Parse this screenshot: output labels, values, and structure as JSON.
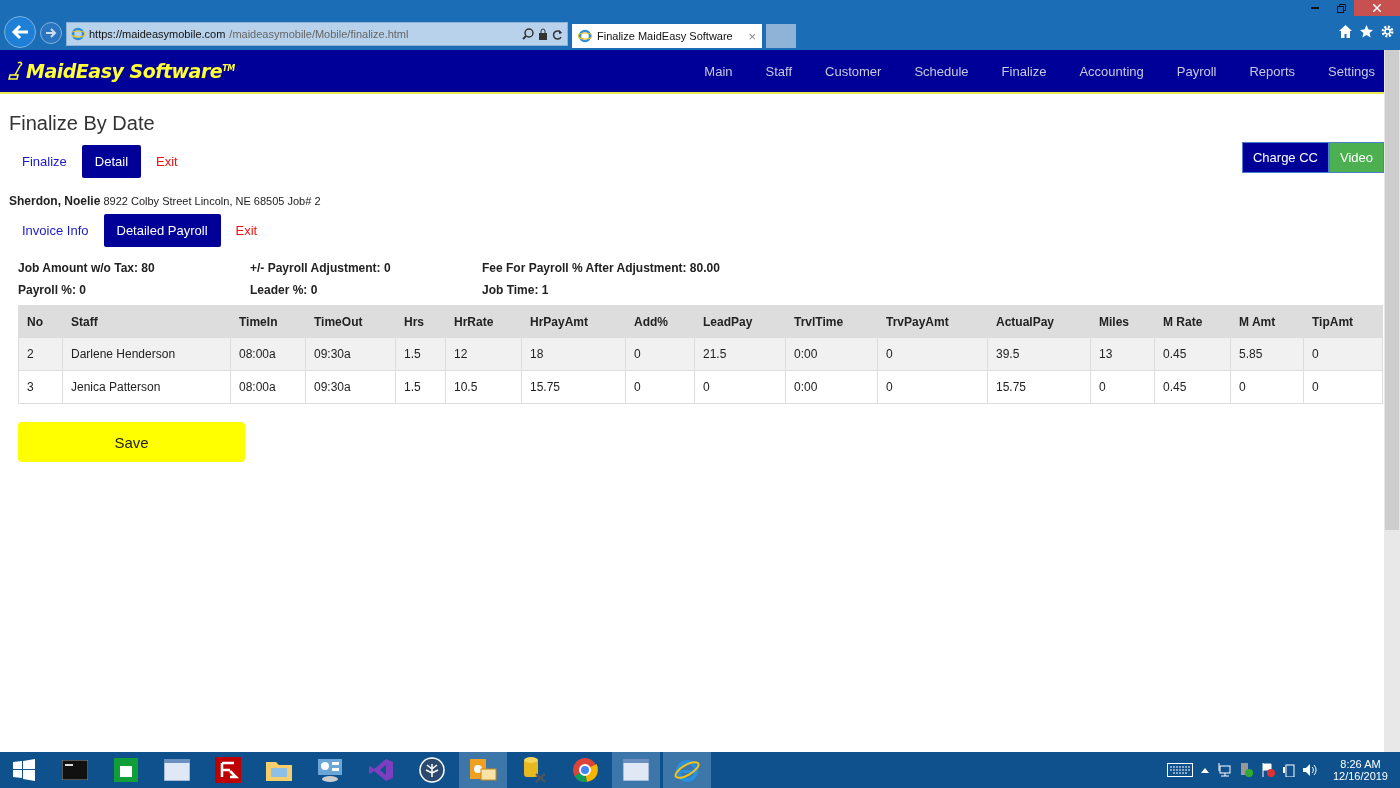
{
  "browser": {
    "address": {
      "host": "https://maideasymobile.com",
      "path": "/maideasymobile/Mobile/finalize.html"
    },
    "tabs": [
      {
        "title": "Finalize MaidEasy Software",
        "close": "×",
        "selected": true
      }
    ]
  },
  "nav": {
    "logo": "MaidEasy Software",
    "trademark": "TM",
    "items": [
      "Main",
      "Staff",
      "Customer",
      "Schedule",
      "Finalize",
      "Accounting",
      "Payroll",
      "Reports",
      "Settings"
    ]
  },
  "page": {
    "title": "Finalize By Date",
    "tabs": [
      {
        "label": "Finalize",
        "kind": "link",
        "selected": false
      },
      {
        "label": "Detail",
        "kind": "link",
        "selected": true
      },
      {
        "label": "Exit",
        "kind": "exit",
        "selected": false
      }
    ],
    "actions": [
      {
        "label": "Charge CC",
        "color": "#000099"
      },
      {
        "label": "Video",
        "color": "#4caf50"
      }
    ],
    "customer": {
      "name": "Sherdon, Noelie",
      "details": "8922 Colby Street Lincoln, NE 68505 Job# 2"
    },
    "subtabs": [
      {
        "label": "Invoice Info",
        "kind": "link",
        "selected": false
      },
      {
        "label": "Detailed Payroll",
        "kind": "link",
        "selected": true
      },
      {
        "label": "Exit",
        "kind": "exit",
        "selected": false
      }
    ],
    "summary": [
      "Job Amount w/o Tax: 80",
      "+/- Payroll Adjustment: 0",
      "Fee For Payroll % After Adjustment: 80.00",
      "Payroll %: 0",
      "Leader %: 0",
      "Job Time: 1"
    ],
    "table": {
      "columns": [
        "No",
        "Staff",
        "TimeIn",
        "TimeOut",
        "Hrs",
        "HrRate",
        "HrPayAmt",
        "Add%",
        "LeadPay",
        "TrvlTime",
        "TrvPayAmt",
        "ActualPay",
        "Miles",
        "M Rate",
        "M Amt",
        "TipAmt"
      ],
      "rows": [
        [
          "2",
          "Darlene Henderson",
          "08:00a",
          "09:30a",
          "1.5",
          "12",
          "18",
          "0",
          "21.5",
          "0:00",
          "0",
          "39.5",
          "13",
          "0.45",
          "5.85",
          "0"
        ],
        [
          "3",
          "Jenica Patterson",
          "08:00a",
          "09:30a",
          "1.5",
          "10.5",
          "15.75",
          "0",
          "0",
          "0:00",
          "0",
          "15.75",
          "0",
          "0.45",
          "0",
          "0"
        ]
      ]
    },
    "save": "Save"
  },
  "taskbar": {
    "apps": [
      {
        "kind": "console",
        "active": false
      },
      {
        "kind": "store",
        "active": false
      },
      {
        "kind": "window",
        "active": false
      },
      {
        "kind": "filezilla",
        "active": false
      },
      {
        "kind": "folder",
        "active": false
      },
      {
        "kind": "control",
        "active": false
      },
      {
        "kind": "studio",
        "active": false
      },
      {
        "kind": "tree",
        "active": false
      },
      {
        "kind": "outlook",
        "active": true
      },
      {
        "kind": "database",
        "active": false
      },
      {
        "kind": "chrome",
        "active": false
      },
      {
        "kind": "window",
        "active": true
      },
      {
        "kind": "ie",
        "active": true
      }
    ],
    "time": "8:26 AM",
    "date": "12/16/2019"
  }
}
